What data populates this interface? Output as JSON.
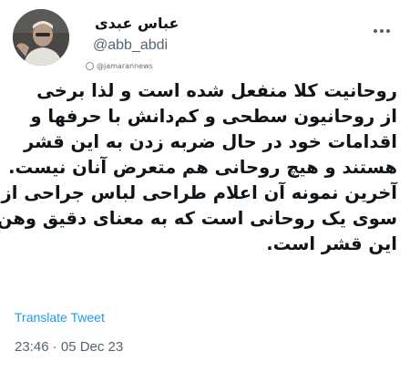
{
  "author": {
    "name": "عباس عبدی",
    "handle": "@abb_abdi"
  },
  "watermark": "@jamarannews",
  "tweet": {
    "lines": [
      "روحانیت کلا منفعل شده است و لذا برخی",
      "از روحانیون سطحی و کم‌دانش با حرفها و",
      "اقدامات خود در حال ضربه زدن به این قشر",
      "هستند و هیچ روحانی هم متعرض آنان نیست.",
      "آخرین نمونه آن اعلام طراحی لباس جراحی از",
      "سوی یک روحانی است که به معنای دقیق وهن",
      "این قشر است."
    ]
  },
  "translate_label": "Translate Tweet",
  "timestamp": "23:46 · 05 Dec 23"
}
